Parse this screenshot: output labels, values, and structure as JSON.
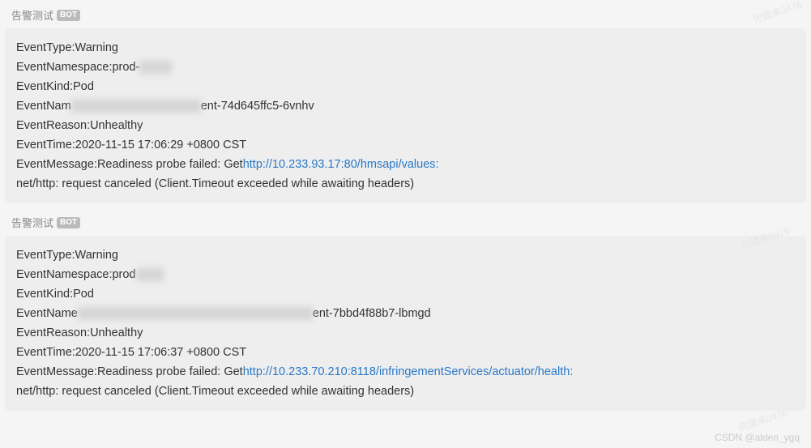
{
  "watermark": "何建来0476",
  "footer": "CSDN @alden_ygq",
  "messages": [
    {
      "sender": "告警测试",
      "badge": "BOT",
      "eventType": "EventType:Warning",
      "eventNamespace_pre": "EventNamespace:prod-",
      "eventKind": "EventKind:Pod",
      "eventName_pre": "EventNam",
      "eventName_post": "ent-74d645ffc5-6vnhv",
      "eventReason": "EventReason:Unhealthy",
      "eventTime": "EventTime:2020-11-15 17:06:29 +0800 CST",
      "eventMessage_pre": "EventMessage:Readiness probe failed: Get ",
      "eventMessage_link": "http://10.233.93.17:80/hmsapi/values:",
      "eventMessage_post": " net/http: request canceled (Client.Timeout exceeded while awaiting headers)",
      "blur_ns": "blur-short",
      "blur_name": "blur-long"
    },
    {
      "sender": "告警测试",
      "badge": "BOT",
      "eventType": "EventType:Warning",
      "eventNamespace_pre": "EventNamespace:prod",
      "eventKind": "EventKind:Pod",
      "eventName_pre": "EventName",
      "eventName_post": "ent-7bbd4f88b7-lbmgd",
      "eventReason": "EventReason:Unhealthy",
      "eventTime": "EventTime:2020-11-15 17:06:37 +0800 CST",
      "eventMessage_pre": "EventMessage:Readiness probe failed: Get ",
      "eventMessage_link": "http://10.233.70.210:8118/infringementServices/actuator/health:",
      "eventMessage_post": " net/http: request canceled (Client.Timeout exceeded while awaiting headers)",
      "blur_ns": "blur-med",
      "blur_name": "blur-xlong"
    }
  ]
}
